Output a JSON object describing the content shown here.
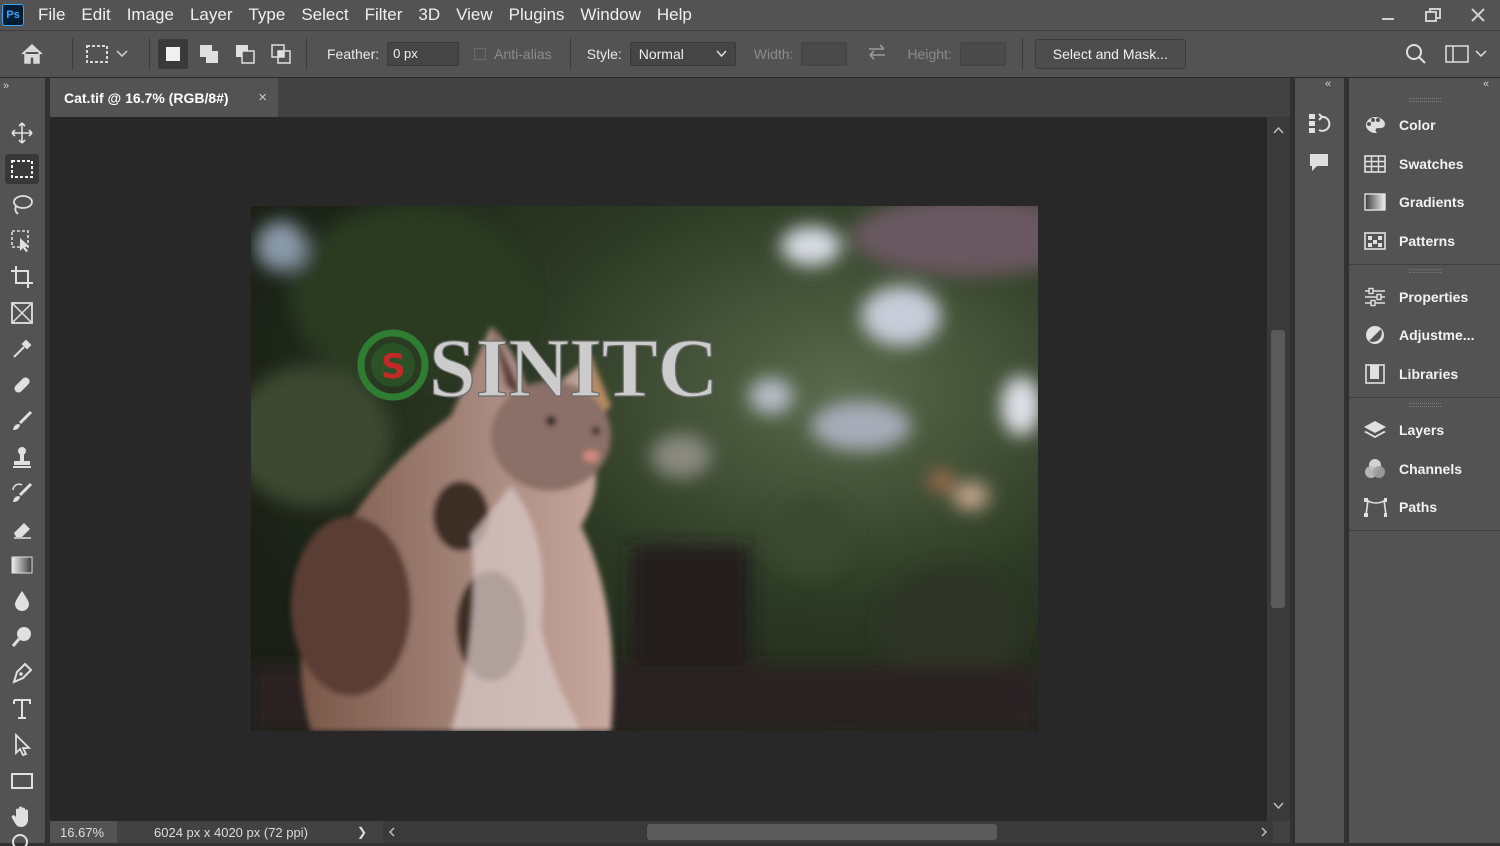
{
  "app": {
    "logo": "Ps"
  },
  "menu": [
    "File",
    "Edit",
    "Image",
    "Layer",
    "Type",
    "Select",
    "Filter",
    "3D",
    "View",
    "Plugins",
    "Window",
    "Help"
  ],
  "window_controls": {
    "minimize": "minimize-icon",
    "restore": "restore-icon",
    "close": "close-icon"
  },
  "options": {
    "feather_label": "Feather:",
    "feather_value": "0 px",
    "antialias_label": "Anti-alias",
    "style_label": "Style:",
    "style_value": "Normal",
    "width_label": "Width:",
    "height_label": "Height:",
    "select_mask_label": "Select and Mask..."
  },
  "document": {
    "tab_title": "Cat.tif @ 16.7% (RGB/8#)",
    "close_glyph": "×"
  },
  "status": {
    "zoom": "16.67%",
    "doc_info": "6024 px x 4020 px (72 ppi)",
    "arrow": "❯"
  },
  "watermark": {
    "text": "SINITC"
  },
  "panels": {
    "group1": [
      {
        "label": "Color",
        "icon": "color-palette-icon"
      },
      {
        "label": "Swatches",
        "icon": "swatches-grid-icon"
      },
      {
        "label": "Gradients",
        "icon": "gradient-icon"
      },
      {
        "label": "Patterns",
        "icon": "patterns-icon"
      }
    ],
    "group2": [
      {
        "label": "Properties",
        "icon": "sliders-icon"
      },
      {
        "label": "Adjustme...",
        "icon": "adjustments-icon"
      },
      {
        "label": "Libraries",
        "icon": "libraries-icon"
      }
    ],
    "group3": [
      {
        "label": "Layers",
        "icon": "layers-icon"
      },
      {
        "label": "Channels",
        "icon": "channels-icon"
      },
      {
        "label": "Paths",
        "icon": "paths-icon"
      }
    ]
  },
  "colors": {
    "ui_bg": "#535353",
    "canvas_bg": "#282828",
    "watermark_green": "#2e7d32",
    "watermark_red": "#c62828"
  }
}
